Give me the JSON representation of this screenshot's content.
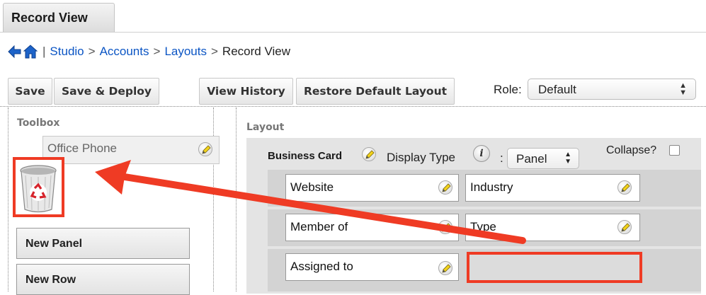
{
  "tab": {
    "label": "Record View"
  },
  "breadcrumb": {
    "studio": "Studio",
    "accounts": "Accounts",
    "layouts": "Layouts",
    "current": "Record View",
    "sep": ">",
    "pipe": "|"
  },
  "toolbar": {
    "save": "Save",
    "save_deploy": "Save & Deploy",
    "view_history": "View History",
    "restore_default": "Restore Default Layout",
    "role_label": "Role:",
    "role_value": "Default"
  },
  "toolbox": {
    "title": "Toolbox",
    "office_phone": "Office Phone",
    "new_panel": "New Panel",
    "new_row": "New Row"
  },
  "layout": {
    "title": "Layout",
    "panel_name": "Business Card",
    "display_type_label": "Display Type",
    "colon": ":",
    "display_type_value": "Panel",
    "collapse_label": "Collapse?",
    "rows": [
      {
        "left": "Website",
        "right": "Industry"
      },
      {
        "left": "Member of",
        "right": "Type"
      },
      {
        "left": "Assigned to",
        "right": ""
      }
    ]
  },
  "colors": {
    "link": "#0b55c4",
    "highlight": "#ef3b24",
    "panel_bg": "#e4e4e4"
  }
}
